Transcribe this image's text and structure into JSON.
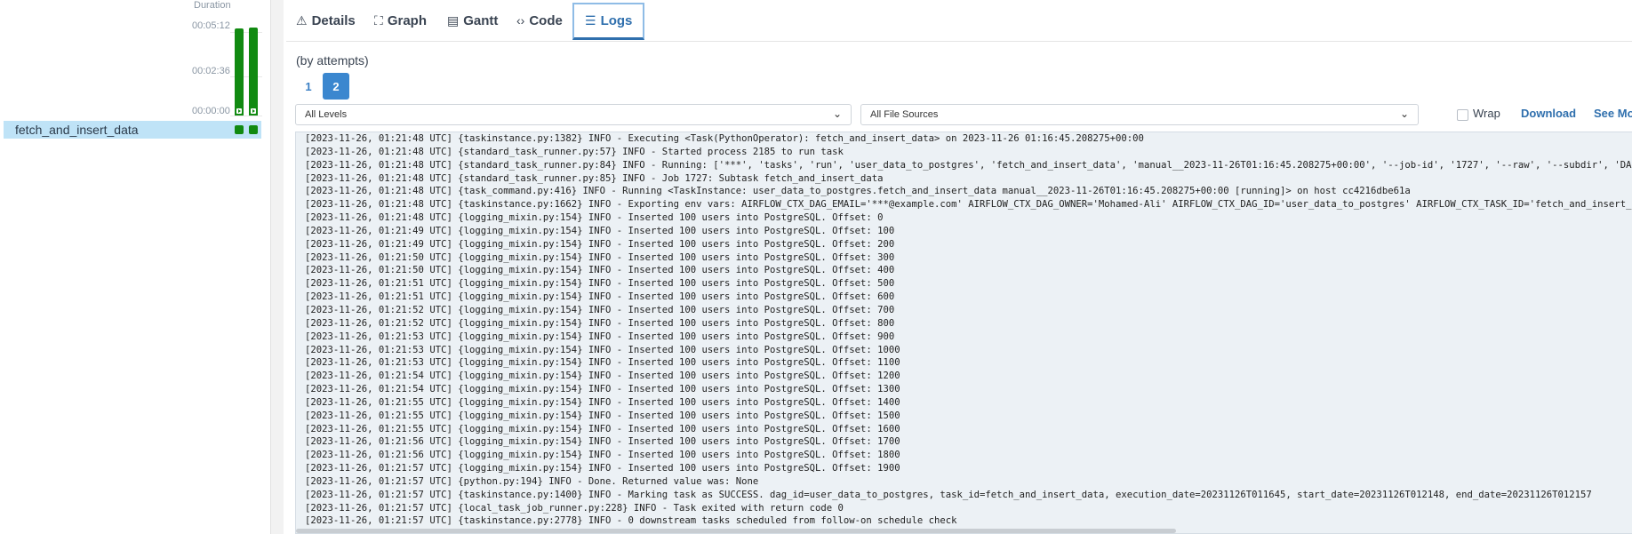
{
  "grid": {
    "duration_label": "Duration",
    "ticks": [
      "00:05:12",
      "00:02:36",
      "00:00:00"
    ],
    "task_name": "fetch_and_insert_data",
    "bar_color": "#118a11"
  },
  "tabs": [
    {
      "label": "Details",
      "icon": "alert-triangle-icon",
      "glyph": "⚠"
    },
    {
      "label": "Graph",
      "icon": "graph-icon",
      "glyph": "⛶"
    },
    {
      "label": "Gantt",
      "icon": "gantt-icon",
      "glyph": "▤"
    },
    {
      "label": "Code",
      "icon": "code-icon",
      "glyph": "‹›"
    },
    {
      "label": "Logs",
      "icon": "logs-icon",
      "glyph": "☰"
    }
  ],
  "attempts": {
    "label": "(by attempts)",
    "items": [
      "1",
      "2"
    ],
    "selected": "2"
  },
  "filters": {
    "levels": "All Levels",
    "sources": "All File Sources",
    "wrap_label": "Wrap",
    "download_label": "Download",
    "see_more_label": "See More"
  },
  "log_lines": [
    "[2023-11-26, 01:21:48 UTC] {taskinstance.py:1382} INFO - Executing <Task(PythonOperator): fetch_and_insert_data> on 2023-11-26 01:16:45.208275+00:00",
    "[2023-11-26, 01:21:48 UTC] {standard_task_runner.py:57} INFO - Started process 2185 to run task",
    "[2023-11-26, 01:21:48 UTC] {standard_task_runner.py:84} INFO - Running: ['***', 'tasks', 'run', 'user_data_to_postgres', 'fetch_and_insert_data', 'manual__2023-11-26T01:16:45.208275+00:00', '--job-id', '1727', '--raw', '--subdir', 'DAGS_FOLDER/DAG API_to_Postgres.py'",
    "[2023-11-26, 01:21:48 UTC] {standard_task_runner.py:85} INFO - Job 1727: Subtask fetch_and_insert_data",
    "[2023-11-26, 01:21:48 UTC] {task_command.py:416} INFO - Running <TaskInstance: user_data_to_postgres.fetch_and_insert_data manual__2023-11-26T01:16:45.208275+00:00 [running]> on host cc4216dbe61a",
    "[2023-11-26, 01:21:48 UTC] {taskinstance.py:1662} INFO - Exporting env vars: AIRFLOW_CTX_DAG_EMAIL='***@example.com' AIRFLOW_CTX_DAG_OWNER='Mohamed-Ali' AIRFLOW_CTX_DAG_ID='user_data_to_postgres' AIRFLOW_CTX_TASK_ID='fetch_and_insert_data' AIRFLOW_CTX_EXECUTION_DATE",
    "[2023-11-26, 01:21:48 UTC] {logging_mixin.py:154} INFO - Inserted 100 users into PostgreSQL. Offset: 0",
    "[2023-11-26, 01:21:49 UTC] {logging_mixin.py:154} INFO - Inserted 100 users into PostgreSQL. Offset: 100",
    "[2023-11-26, 01:21:49 UTC] {logging_mixin.py:154} INFO - Inserted 100 users into PostgreSQL. Offset: 200",
    "[2023-11-26, 01:21:50 UTC] {logging_mixin.py:154} INFO - Inserted 100 users into PostgreSQL. Offset: 300",
    "[2023-11-26, 01:21:50 UTC] {logging_mixin.py:154} INFO - Inserted 100 users into PostgreSQL. Offset: 400",
    "[2023-11-26, 01:21:51 UTC] {logging_mixin.py:154} INFO - Inserted 100 users into PostgreSQL. Offset: 500",
    "[2023-11-26, 01:21:51 UTC] {logging_mixin.py:154} INFO - Inserted 100 users into PostgreSQL. Offset: 600",
    "[2023-11-26, 01:21:52 UTC] {logging_mixin.py:154} INFO - Inserted 100 users into PostgreSQL. Offset: 700",
    "[2023-11-26, 01:21:52 UTC] {logging_mixin.py:154} INFO - Inserted 100 users into PostgreSQL. Offset: 800",
    "[2023-11-26, 01:21:53 UTC] {logging_mixin.py:154} INFO - Inserted 100 users into PostgreSQL. Offset: 900",
    "[2023-11-26, 01:21:53 UTC] {logging_mixin.py:154} INFO - Inserted 100 users into PostgreSQL. Offset: 1000",
    "[2023-11-26, 01:21:53 UTC] {logging_mixin.py:154} INFO - Inserted 100 users into PostgreSQL. Offset: 1100",
    "[2023-11-26, 01:21:54 UTC] {logging_mixin.py:154} INFO - Inserted 100 users into PostgreSQL. Offset: 1200",
    "[2023-11-26, 01:21:54 UTC] {logging_mixin.py:154} INFO - Inserted 100 users into PostgreSQL. Offset: 1300",
    "[2023-11-26, 01:21:55 UTC] {logging_mixin.py:154} INFO - Inserted 100 users into PostgreSQL. Offset: 1400",
    "[2023-11-26, 01:21:55 UTC] {logging_mixin.py:154} INFO - Inserted 100 users into PostgreSQL. Offset: 1500",
    "[2023-11-26, 01:21:55 UTC] {logging_mixin.py:154} INFO - Inserted 100 users into PostgreSQL. Offset: 1600",
    "[2023-11-26, 01:21:56 UTC] {logging_mixin.py:154} INFO - Inserted 100 users into PostgreSQL. Offset: 1700",
    "[2023-11-26, 01:21:56 UTC] {logging_mixin.py:154} INFO - Inserted 100 users into PostgreSQL. Offset: 1800",
    "[2023-11-26, 01:21:57 UTC] {logging_mixin.py:154} INFO - Inserted 100 users into PostgreSQL. Offset: 1900",
    "[2023-11-26, 01:21:57 UTC] {python.py:194} INFO - Done. Returned value was: None",
    "[2023-11-26, 01:21:57 UTC] {taskinstance.py:1400} INFO - Marking task as SUCCESS. dag_id=user_data_to_postgres, task_id=fetch_and_insert_data, execution_date=20231126T011645, start_date=20231126T012148, end_date=20231126T012157",
    "[2023-11-26, 01:21:57 UTC] {local_task_job_runner.py:228} INFO - Task exited with return code 0",
    "[2023-11-26, 01:21:57 UTC] {taskinstance.py:2778} INFO - 0 downstream tasks scheduled from follow-on schedule check"
  ]
}
